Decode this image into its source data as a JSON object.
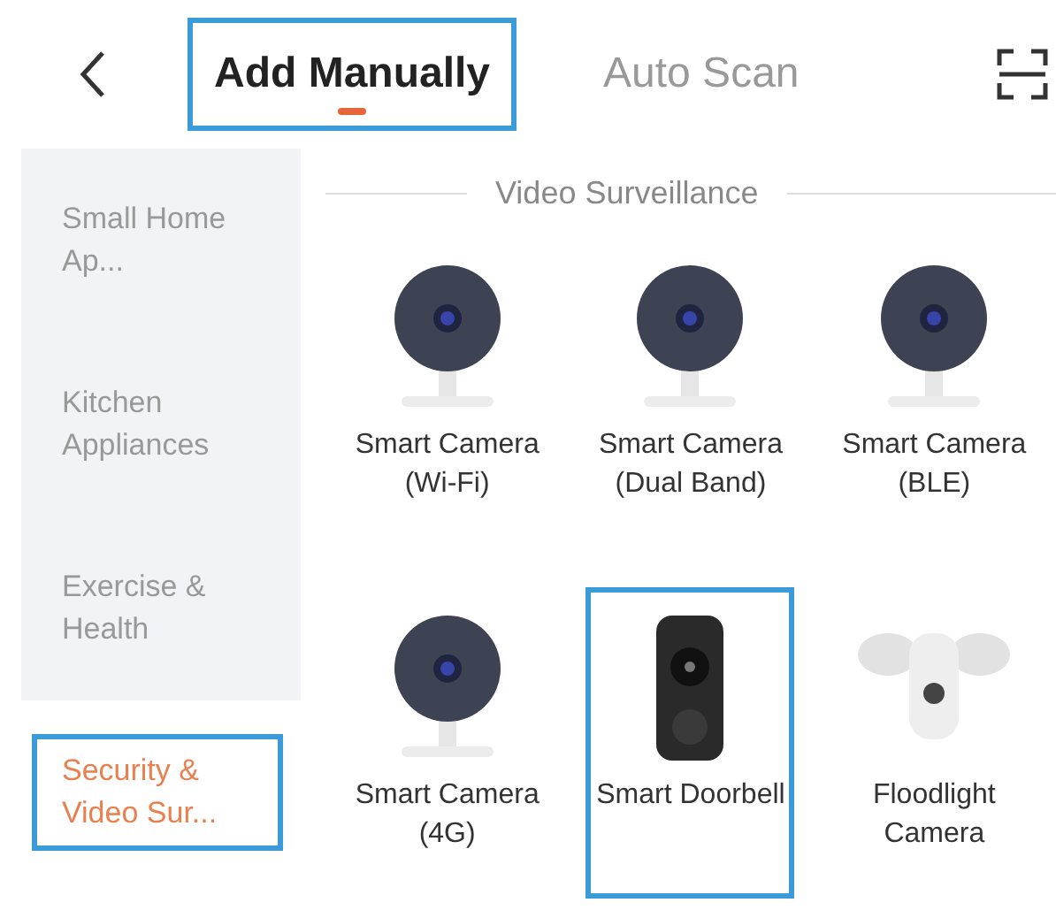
{
  "header": {
    "tabs": [
      {
        "label": "Add Manually",
        "selected": true,
        "highlighted": true
      },
      {
        "label": "Auto Scan",
        "selected": false,
        "highlighted": false
      }
    ]
  },
  "sidebar": {
    "items": [
      {
        "label": "Small Home Ap...",
        "selected": false,
        "highlighted": false
      },
      {
        "label": "Kitchen Appliances",
        "selected": false,
        "highlighted": false
      },
      {
        "label": "Exercise & Health",
        "selected": false,
        "highlighted": false
      },
      {
        "label": "Security & Video Sur...",
        "selected": true,
        "highlighted": true
      }
    ]
  },
  "section": {
    "title": "Video Surveillance",
    "devices": [
      {
        "kind": "camera",
        "label": "Smart Camera (Wi-Fi)",
        "highlighted": false
      },
      {
        "kind": "camera",
        "label": "Smart Camera (Dual Band)",
        "highlighted": false
      },
      {
        "kind": "camera",
        "label": "Smart Camera (BLE)",
        "highlighted": false
      },
      {
        "kind": "camera",
        "label": "Smart Camera (4G)",
        "highlighted": false
      },
      {
        "kind": "doorbell",
        "label": "Smart Doorbell",
        "highlighted": true
      },
      {
        "kind": "floodlight",
        "label": "Floodlight Camera",
        "highlighted": false
      }
    ]
  }
}
